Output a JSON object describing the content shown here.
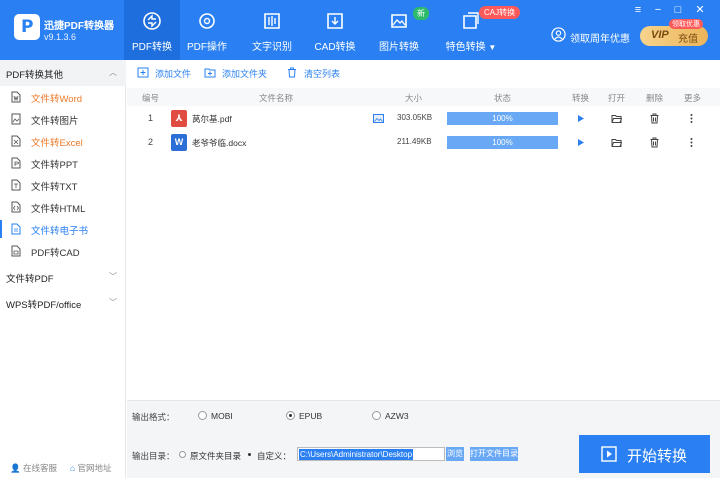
{
  "app": {
    "name": "迅捷PDF转换器",
    "version": "v9.1.3.6"
  },
  "nav": {
    "tabs": [
      {
        "label": "PDF转换",
        "icon": "pdf-convert-icon"
      },
      {
        "label": "PDF操作",
        "icon": "pdf-operate-icon"
      },
      {
        "label": "文字识别",
        "icon": "ocr-icon"
      },
      {
        "label": "CAD转换",
        "icon": "cad-icon"
      },
      {
        "label": "图片转换",
        "icon": "image-convert-icon"
      },
      {
        "label": "特色转换",
        "icon": "special-convert-icon"
      }
    ],
    "badge_new": "新",
    "badge_caj": "CAJ转换",
    "anniversary": "领取周年优惠",
    "vip_tag": "领取优惠",
    "vip": "VIP",
    "recharge": "充值",
    "window_controls": [
      "≡",
      "−",
      "□",
      "✕"
    ]
  },
  "sidebar": {
    "groups": [
      {
        "label": "PDF转换其他",
        "open": true
      },
      {
        "label": "文件转PDF",
        "open": false
      },
      {
        "label": "WPS转PDF/office",
        "open": false
      }
    ],
    "items": [
      {
        "label": "文件转Word",
        "icon": "word-file-icon",
        "state": "highlight"
      },
      {
        "label": "文件转图片",
        "icon": "image-file-icon",
        "state": "normal"
      },
      {
        "label": "文件转Excel",
        "icon": "excel-file-icon",
        "state": "highlight"
      },
      {
        "label": "文件转PPT",
        "icon": "ppt-file-icon",
        "state": "normal"
      },
      {
        "label": "文件转TXT",
        "icon": "txt-file-icon",
        "state": "normal"
      },
      {
        "label": "文件转HTML",
        "icon": "html-file-icon",
        "state": "normal"
      },
      {
        "label": "文件转电子书",
        "icon": "ebook-file-icon",
        "state": "active"
      },
      {
        "label": "PDF转CAD",
        "icon": "cad-file-icon",
        "state": "normal"
      }
    ],
    "footer": {
      "service": "在线客服",
      "website": "官网地址"
    }
  },
  "toolbar": {
    "add_file": "添加文件",
    "add_folder": "添加文件夹",
    "clear_list": "清空列表"
  },
  "table": {
    "headers": {
      "index": "编号",
      "name": "文件名称",
      "size": "大小",
      "status": "状态",
      "convert": "转换",
      "open": "打开",
      "delete": "删除",
      "more": "更多"
    },
    "rows": [
      {
        "index": "1",
        "name": "莴尔基.pdf",
        "type": "pdf",
        "size": "303.05KB",
        "progress": 100,
        "progress_label": "100%"
      },
      {
        "index": "2",
        "name": "老爷爷临.docx",
        "type": "docx",
        "size": "211.49KB",
        "progress": 100,
        "progress_label": "100%"
      }
    ]
  },
  "output": {
    "format_label": "输出格式：",
    "formats": [
      {
        "label": "MOBI",
        "selected": false
      },
      {
        "label": "EPUB",
        "selected": true
      },
      {
        "label": "AZW3",
        "selected": false
      }
    ],
    "dir_label": "输出目录：",
    "dir_options": [
      {
        "label": "原文件夹目录",
        "selected": false
      },
      {
        "label": "自定义：",
        "selected": true
      }
    ],
    "path": "C:\\Users\\Administrator\\Desktop",
    "browse": "浏览",
    "open_folder": "打开文件目录",
    "start": "开始转换"
  },
  "colors": {
    "accent": "#2a80f2",
    "highlight": "#ee7a2a",
    "progress": "#69a8f5",
    "pdf": "#e04c41",
    "word": "#2b6fd6"
  }
}
